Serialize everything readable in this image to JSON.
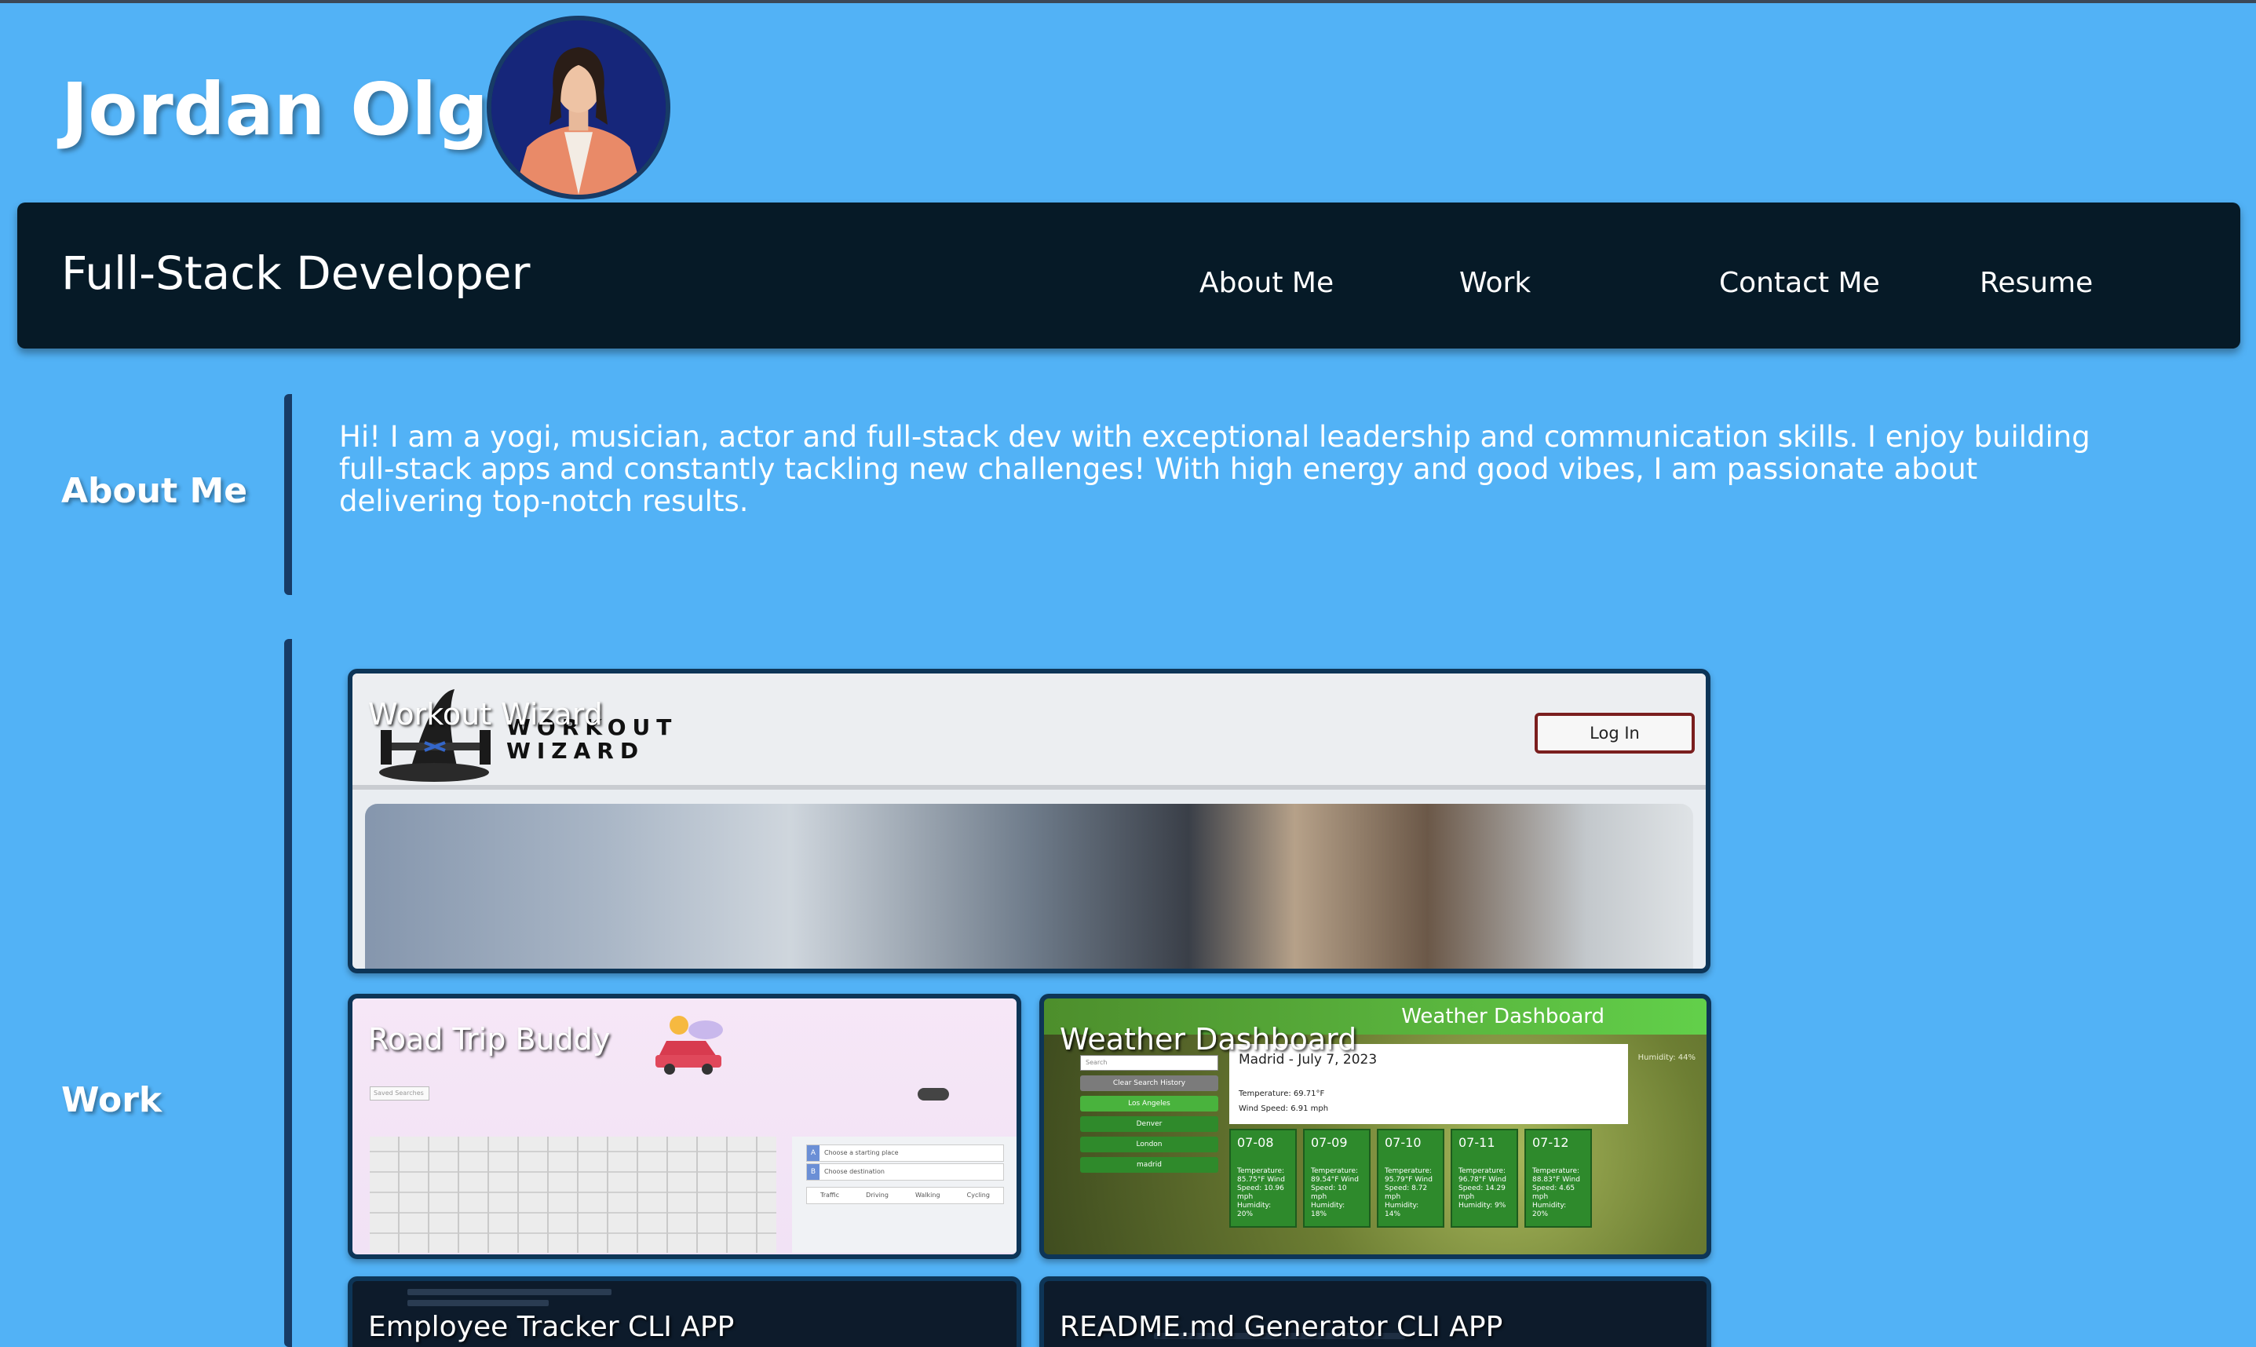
{
  "header": {
    "name": "Jordan Olguin",
    "role": "Full-Stack Developer"
  },
  "nav": {
    "links": [
      "About Me",
      "Work",
      "Contact Me",
      "Resume"
    ]
  },
  "about": {
    "label": "About Me",
    "text": "Hi! I am a yogi, musician, actor and full-stack dev with exceptional leadership and communication skills. I enjoy building full-stack apps and constantly tackling new challenges! With high energy and good vibes, I am passionate about delivering top-notch results."
  },
  "work": {
    "label": "Work",
    "projects": [
      {
        "title": "Workout Wizard",
        "logo_line1": "WORKOUT",
        "logo_line2": "WIZARD",
        "button": "Log In"
      },
      {
        "title": "Road Trip Buddy",
        "select": "Saved Searches",
        "rows": [
          "Choose a starting place",
          "Choose destination"
        ],
        "modes": [
          "Traffic",
          "Driving",
          "Walking",
          "Cycling"
        ]
      },
      {
        "title": "Weather Dashboard",
        "band_title": "Weather Dashboard",
        "search_placeholder": "Search",
        "search_button": "Search",
        "clear_button": "Clear Search History",
        "cities": [
          "Los Angeles",
          "Denver",
          "London",
          "madrid"
        ],
        "current": {
          "city": "Madrid - July 7, 2023",
          "temp": "Temperature: 69.71°F",
          "wind": "Wind Speed: 6.91 mph",
          "humidity": "Humidity: 44%"
        },
        "forecast": [
          {
            "date": "07-08",
            "info": "Temperature: 85.75°F Wind Speed: 10.96 mph Humidity: 20%"
          },
          {
            "date": "07-09",
            "info": "Temperature: 89.54°F Wind Speed: 10 mph Humidity: 18%"
          },
          {
            "date": "07-10",
            "info": "Temperature: 95.79°F Wind Speed: 8.72 mph Humidity: 14%"
          },
          {
            "date": "07-11",
            "info": "Temperature: 96.78°F Wind Speed: 14.29 mph Humidity: 9%"
          },
          {
            "date": "07-12",
            "info": "Temperature: 88.83°F Wind Speed: 4.65 mph Humidity: 20%"
          }
        ]
      },
      {
        "title": "Employee Tracker CLI APP"
      },
      {
        "title": "README.md Generator CLI APP"
      }
    ]
  },
  "colors": {
    "background": "#52b2f6",
    "navbar": "#061a27",
    "accent_border": "#173b66"
  }
}
